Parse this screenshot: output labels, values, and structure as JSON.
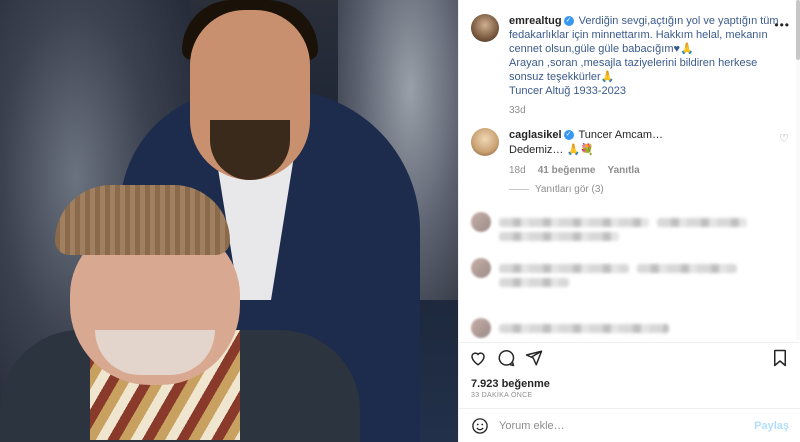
{
  "post": {
    "username": "emrealtug",
    "caption_lines": [
      "Verdiğin sevgi,açtığın yol ve yaptığın tüm fedakarlıklar için minnettarım. Hakkım helal, mekanın cennet olsun,güle güle babacığım♥🙏",
      "Arayan ,soran ,mesajla taziyelerini bildiren herkese sonsuz teşekkürler🙏",
      "Tuncer Altuğ 1933-2023"
    ],
    "caption_age": "33d",
    "likes": "7.923 beğenme",
    "time_ago": "33 DAKİKA ÖNCE"
  },
  "comment": {
    "username": "caglasikel",
    "text": "Tuncer Amcam…",
    "text2": "Dedemiz… 🙏💐",
    "age": "18d",
    "likes": "41 beğenme",
    "reply": "Yanıtla",
    "view_replies": "Yanıtları gör (3)"
  },
  "comment_box": {
    "placeholder": "Yorum ekle…",
    "post_label": "Paylaş"
  },
  "icons": {
    "more": "more-icon",
    "heart": "heart-icon",
    "comment": "comment-icon",
    "share": "share-icon",
    "bookmark": "bookmark-icon",
    "emoji": "emoji-icon"
  },
  "colors": {
    "verified": "#3897f0",
    "post_button": "#b2dffc",
    "muted": "#8e8e8e"
  }
}
